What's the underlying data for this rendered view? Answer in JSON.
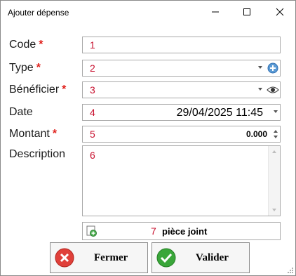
{
  "window": {
    "title": "Ajouter dépense"
  },
  "form": {
    "code": {
      "label": "Code",
      "required": "*",
      "value": "1"
    },
    "type": {
      "label": "Type",
      "required": "*",
      "value": "2"
    },
    "beneficiaire": {
      "label": "Bénéficier",
      "required": "*",
      "value": "3"
    },
    "date": {
      "label": "Date",
      "marker": "4",
      "value": "29/04/2025 11:45"
    },
    "montant": {
      "label": "Montant",
      "required": "*",
      "marker": "5",
      "value": "0.000"
    },
    "description": {
      "label": "Description",
      "value": "6"
    },
    "attachment": {
      "marker": "7",
      "label": "pièce joint"
    }
  },
  "buttons": {
    "close": "Fermer",
    "validate": "Valider"
  },
  "colors": {
    "required": "#e0201b",
    "marker": "#c8102e",
    "close": "#e0403a",
    "validate": "#3aa63a"
  }
}
